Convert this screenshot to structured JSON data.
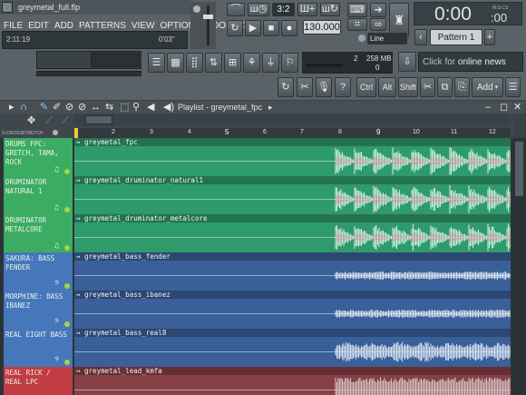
{
  "title_bar": {
    "filename": "greymetal_full.flp"
  },
  "menu": {
    "items": [
      "FILE",
      "EDIT",
      "ADD",
      "PATTERNS",
      "VIEW",
      "OPTIONS",
      "TOOLS",
      "?"
    ]
  },
  "hint": {
    "time": "2:11:19",
    "value": "0'03\""
  },
  "transport": {
    "tempo": "130.000",
    "step": "3:2",
    "mode": "Line"
  },
  "time_display": {
    "value": "0:00",
    "sub": ":00",
    "label": "M:S:CS"
  },
  "pattern": {
    "label": "Pattern 1"
  },
  "cpu": {
    "voices": "2",
    "memory": "258 MB",
    "poly": "0"
  },
  "news": {
    "prefix": "Click for ",
    "link": "online news"
  },
  "toolbar2": {
    "ctrl": "Ctrl",
    "alt": "Alt",
    "shift": "Shift",
    "add": "Add"
  },
  "playlist": {
    "title": "Playlist - greymetal_fpc",
    "arrow": "▸"
  },
  "ruler": {
    "labels": [
      "2",
      "3",
      "4",
      "5",
      "6",
      "7",
      "8",
      "9",
      "10",
      "11",
      "12"
    ]
  },
  "view_labels": {
    "xcross": "X-CROSS",
    "stretch": "STRETCH"
  },
  "tracks": [
    {
      "name": "DRUMS FPC: GRETCH, TAMA, ROCK",
      "clip": "greymetal_fpc",
      "type": "drum"
    },
    {
      "name": "DRUMINATOR NATURAL 1",
      "clip": "greymetal_druminator_natural1",
      "type": "drum"
    },
    {
      "name": "DRUMINATOR METALCORE",
      "clip": "greymetal_druminator_metalcore",
      "type": "drum"
    },
    {
      "name": "SAKURA: BASS FENDER",
      "clip": "greymetal_bass_fender",
      "type": "bass"
    },
    {
      "name": "MORPHINE: BASS IBANEZ",
      "clip": "greymetal_bass_ibanez",
      "type": "bass"
    },
    {
      "name": "REAL EIGHT BASS",
      "clip": "greymetal_bass_real8",
      "type": "bass"
    },
    {
      "name": "REAL RICK / REAL LPC",
      "clip": "greymetal_lead_kmfa",
      "type": "lead"
    }
  ],
  "colors": {
    "drum": "#2f9a6b",
    "drum_name": "#3cac62",
    "bass": "#3a5f99",
    "bass_name": "#4677bb",
    "lead": "#864046",
    "lead_name": "#c23c43"
  }
}
